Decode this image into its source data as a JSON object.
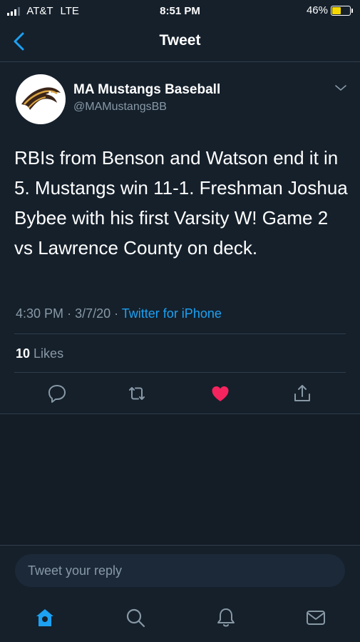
{
  "status": {
    "carrier": "AT&T",
    "network": "LTE",
    "time": "8:51 PM",
    "battery": "46%",
    "battery_fraction": 0.46,
    "battery_color": "#f6d800"
  },
  "nav": {
    "title": "Tweet",
    "back_icon": "chevron-left-icon"
  },
  "tweet": {
    "author_name": "MA Mustangs Baseball",
    "author_handle": "@MAMustangsBB",
    "text": "RBIs from Benson and Watson end it in 5. Mustangs win 11-1. Freshman Joshua Bybee with his first Varsity W! Game 2 vs Lawrence County on deck.",
    "time": "4:30 PM",
    "date": "3/7/20",
    "source": "Twitter for iPhone",
    "likes_count": "10",
    "likes_label": "Likes",
    "liked": true,
    "like_color": "#f4245e"
  },
  "reply": {
    "placeholder": "Tweet your reply"
  },
  "tabs": [
    {
      "icon": "home-icon",
      "active": true
    },
    {
      "icon": "search-icon"
    },
    {
      "icon": "notifications-icon"
    },
    {
      "icon": "messages-icon"
    }
  ],
  "colors": {
    "accent": "#1da1f2",
    "background": "#15202b",
    "muted_text": "#8899a6"
  }
}
